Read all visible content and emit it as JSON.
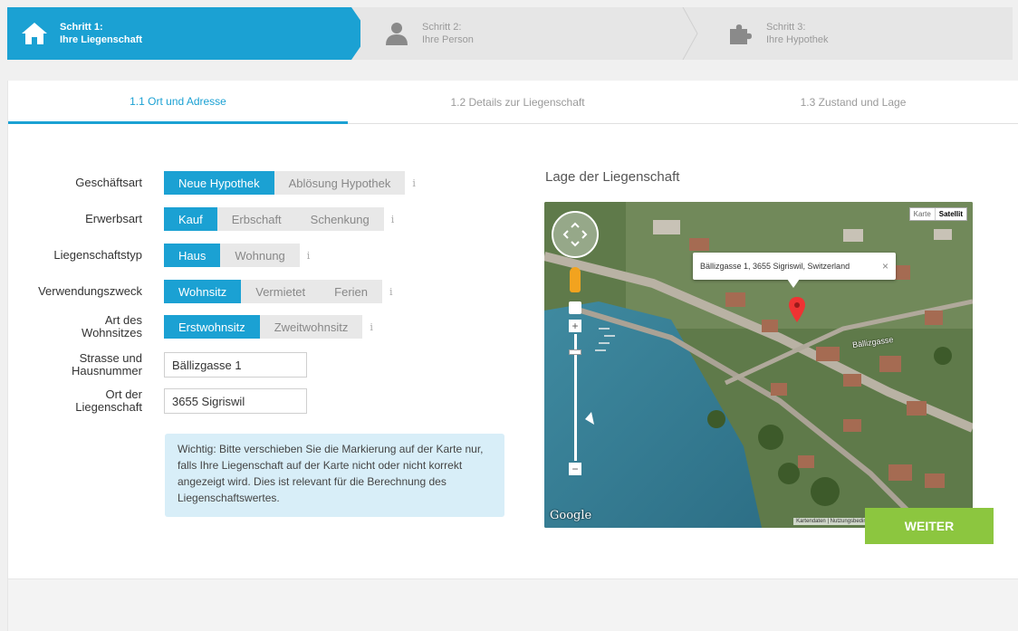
{
  "steps": [
    {
      "line1": "Schritt 1:",
      "line2": "Ihre Liegenschaft",
      "icon": "house-icon"
    },
    {
      "line1": "Schritt 2:",
      "line2": "Ihre Person",
      "icon": "person-icon"
    },
    {
      "line1": "Schritt 3:",
      "line2": "Ihre Hypothek",
      "icon": "puzzle-icon"
    }
  ],
  "tabs": [
    "1.1 Ort und Adresse",
    "1.2 Details zur Liegenschaft",
    "1.3 Zustand und Lage"
  ],
  "form": {
    "geschaeftsart": {
      "label": "Geschäftsart",
      "options": [
        "Neue Hypothek",
        "Ablösung Hypothek"
      ],
      "selected": "Neue Hypothek"
    },
    "erwerbsart": {
      "label": "Erwerbsart",
      "options": [
        "Kauf",
        "Erbschaft",
        "Schenkung"
      ],
      "selected": "Kauf"
    },
    "liegenschaftstyp": {
      "label": "Liegenschaftstyp",
      "options": [
        "Haus",
        "Wohnung"
      ],
      "selected": "Haus"
    },
    "verwendungszweck": {
      "label": "Verwendungszweck",
      "options": [
        "Wohnsitz",
        "Vermietet",
        "Ferien"
      ],
      "selected": "Wohnsitz"
    },
    "art_wohnsitz": {
      "label_line1": "Art des",
      "label_line2": "Wohnsitzes",
      "options": [
        "Erstwohnsitz",
        "Zweitwohnsitz"
      ],
      "selected": "Erstwohnsitz"
    },
    "strasse": {
      "label_line1": "Strasse und",
      "label_line2": "Hausnummer",
      "value": "Bällizgasse 1"
    },
    "ort": {
      "label_line1": "Ort der",
      "label_line2": "Liegenschaft",
      "value": "3655 Sigriswil"
    },
    "info_glyph": "i"
  },
  "note": "Wichtig: Bitte verschieben Sie die Markierung auf der Karte nur, falls Ihre Liegenschaft auf der Karte nicht oder nicht korrekt angezeigt wird. Dies ist relevant für die Berechnung des Liegenschaftswertes.",
  "map": {
    "title": "Lage der Liegenschaft",
    "popup": "Bällizgasse 1, 3655 Sigriswil, Switzerland",
    "popup_close": "×",
    "type_karte": "Karte",
    "type_satellit": "Satellit",
    "google": "Google",
    "footer": "Kartendaten | Nutzungsbedingungen | Fehler bei Google Maps melden",
    "zoom_plus": "+",
    "zoom_minus": "−",
    "street_label": "Bällizgasse"
  },
  "button": {
    "weiter": "WEITER"
  },
  "colors": {
    "accent": "#1ba1d3",
    "button": "#8cc63f",
    "note_bg": "#d8eef8"
  }
}
